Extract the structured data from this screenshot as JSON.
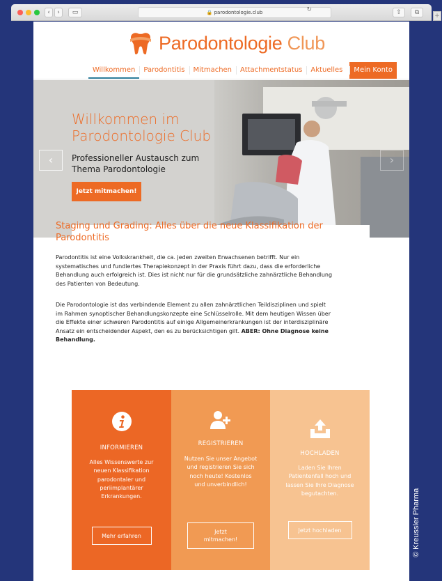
{
  "browser": {
    "url": "parodontologie.club"
  },
  "logo": {
    "name_part1": "Parodontologie",
    "name_part2": "Club"
  },
  "nav": {
    "items": [
      "Willkommen",
      "Parodontitis",
      "Mitmachen",
      "Attachmentstatus",
      "Aktuelles"
    ],
    "account": "Mein Konto"
  },
  "hero": {
    "title": "Willkommen im Parodontologie Club",
    "subtitle": "Professioneller Austausch zum Thema Parodontologie",
    "button": "Jetzt mitmachen!"
  },
  "article": {
    "title": "Staging und Grading: Alles über die neue Klassifikation der Parodontitis",
    "p1": "Parodontitis ist eine Volkskrankheit, die ca. jeden zweiten Erwachsenen betrifft. Nur ein systematisches und fundiertes Therapiekonzept in der Praxis führt dazu, dass die erforderliche Behandlung auch erfolgreich ist. Dies ist nicht nur für die grundsätzliche zahnärztliche Behandlung des Patienten von Bedeutung.",
    "p2": "Die Parodontologie ist das verbindende Element zu allen zahnärztlichen Teildisziplinen und spielt im Rahmen synoptischer Behandlungskonzepte eine Schlüsselrolle. Mit dem heutigen Wissen über die Effekte einer schweren Parodontitis auf einige Allgemeinerkrankungen ist der interdisziplinäre Ansatz ein entscheidender Aspekt, den es zu berücksichtigen gilt.",
    "p2_bold": "ABER: Ohne Diagnose keine Behandlung."
  },
  "boxes": [
    {
      "icon": "info-icon",
      "heading": "INFORMIEREN",
      "text": "Alles Wissenswerte zur neuen Klassifikation parodontaler und periimplantärer Erkrankungen.",
      "button": "Mehr erfahren",
      "color": "#ec6725"
    },
    {
      "icon": "add-user-icon",
      "heading": "REGISTRIEREN",
      "text": "Nutzen Sie unser Angebot und registrieren Sie sich noch heute! Kostenlos und unverbindlich!",
      "button": "Jetzt mitmachen!",
      "color": "#f19a53"
    },
    {
      "icon": "upload-icon",
      "heading": "HOCHLADEN",
      "text": "Laden Sie Ihren Patientenfall hoch und lassen Sie Ihre Diagnose begutachten.",
      "button": "Jetzt hochladen",
      "color": "#f7c391"
    }
  ],
  "copyright": "© Kreussler Pharma"
}
